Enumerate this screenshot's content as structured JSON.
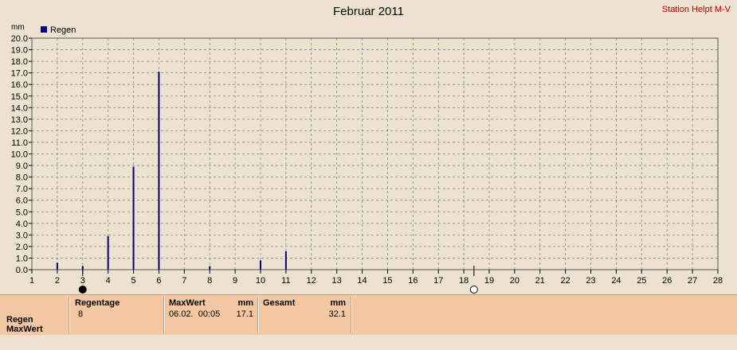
{
  "header": {
    "title": "Februar 2011",
    "station": "Station Helpt M-V"
  },
  "colors": {
    "bar": "#000080",
    "grid": "#8a8a8a",
    "background": "#ece2cf",
    "footer": "#f2c7a1",
    "station_text": "#c00000"
  },
  "chart_data": {
    "type": "bar",
    "title": "Februar 2011",
    "ylabel": "mm",
    "xlabel": "",
    "xlim": [
      1,
      28
    ],
    "ylim": [
      0,
      20
    ],
    "x_ticks": [
      1,
      2,
      3,
      4,
      5,
      6,
      7,
      8,
      9,
      10,
      11,
      12,
      13,
      14,
      15,
      16,
      17,
      18,
      19,
      20,
      21,
      22,
      23,
      24,
      25,
      26,
      27,
      28
    ],
    "y_ticks": [
      "0.0",
      "1.0",
      "2.0",
      "3.0",
      "4.0",
      "5.0",
      "6.0",
      "7.0",
      "8.0",
      "9.0",
      "10.0",
      "11.0",
      "12.0",
      "13.0",
      "14.0",
      "15.0",
      "16.0",
      "17.0",
      "18.0",
      "19.0",
      "20.0"
    ],
    "grid": true,
    "legend": "top-left",
    "series": [
      {
        "name": "Regen",
        "points": [
          {
            "x": 2,
            "y": 0.6
          },
          {
            "x": 3,
            "y": 0.3
          },
          {
            "x": 4,
            "y": 2.9
          },
          {
            "x": 5,
            "y": 8.9
          },
          {
            "x": 6,
            "y": 17.1
          },
          {
            "x": 8,
            "y": 0.3
          },
          {
            "x": 10,
            "y": 0.8
          },
          {
            "x": 11,
            "y": 1.6
          }
        ]
      }
    ],
    "moon_phases": [
      {
        "x": 3,
        "phase": "new-moon"
      },
      {
        "x": 18.4,
        "phase": "full-moon"
      }
    ]
  },
  "footer": {
    "row_labels": [
      "Regen",
      "MaxWert"
    ],
    "regentage": {
      "header": "Regentage",
      "value": "8"
    },
    "maxwert": {
      "header": "MaxWert",
      "unit": "mm",
      "datetime": "06.02.  00:05",
      "value": "17.1"
    },
    "gesamt": {
      "header": "Gesamt",
      "unit": "mm",
      "value": "32.1"
    }
  }
}
